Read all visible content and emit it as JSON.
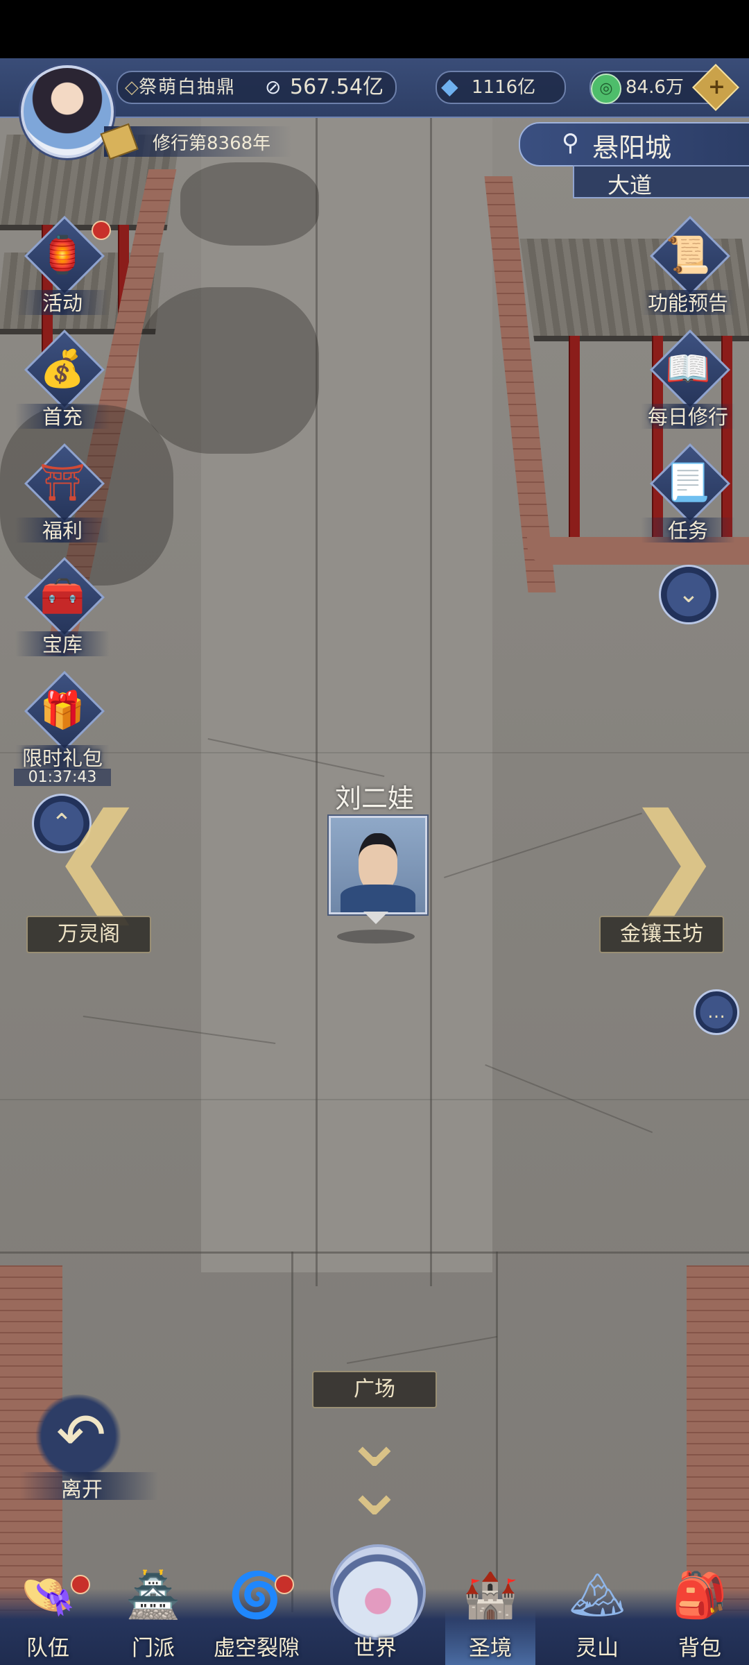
{
  "topbar": {
    "banner_text": "祭萌白抽鼎",
    "power_value": "567.54亿",
    "crystal_value": "1116亿",
    "jade_value": "84.6万",
    "add_symbol": "+",
    "cultivation_year": "修行第8368年"
  },
  "location": {
    "city": "悬阳城",
    "area": "大道"
  },
  "left_menu": {
    "activity": "活动",
    "first_recharge": "首充",
    "welfare": "福利",
    "treasury": "宝库",
    "limited_pack": "限时礼包",
    "limited_timer": "01:37:43"
  },
  "right_menu": {
    "feature_preview": "功能预告",
    "daily_practice": "每日修行",
    "tasks": "任务"
  },
  "npc": {
    "name": "刘二娃"
  },
  "places": {
    "left": "万灵阁",
    "right": "金镶玉坊",
    "bottom": "广场"
  },
  "leave_label": "离开",
  "bottom_nav": {
    "team": "队伍",
    "sect": "门派",
    "void_rift": "虚空裂隙",
    "world": "世界",
    "holy_realm": "圣境",
    "spirit_mountain": "灵山",
    "backpack": "背包"
  },
  "colors": {
    "ui_navy": "#2e3f66",
    "gold_accent": "#e9cf8a",
    "notification_red": "#c8302a"
  }
}
